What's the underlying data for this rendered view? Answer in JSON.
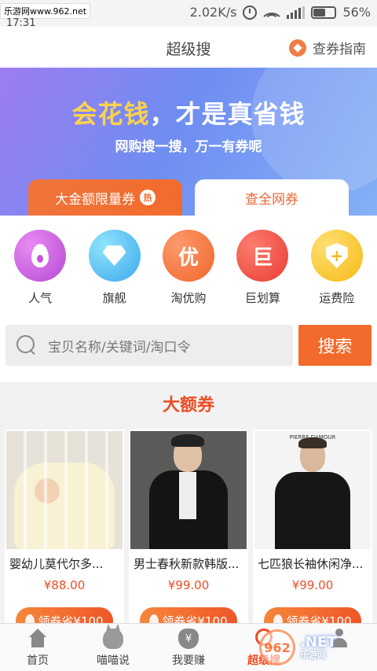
{
  "status_bar": {
    "watermark": "乐游网www.962.net",
    "time_fragment": "17:31",
    "speed": "2.02K/s",
    "battery": "56%"
  },
  "header": {
    "title": "超级搜",
    "guide_label": "查券指南"
  },
  "banner": {
    "headline_gold": "会花钱",
    "headline_rest": "，才是真省钱",
    "subline": "网购搜一搜，万一有券呢",
    "tabs": [
      {
        "label": "大金额限量券",
        "badge": "热"
      },
      {
        "label": "查全网券"
      }
    ]
  },
  "categories": [
    {
      "label": "人气",
      "icon": "flame-icon",
      "color": "#c257d9"
    },
    {
      "label": "旗舰",
      "icon": "diamond-icon",
      "color": "#3da8ee"
    },
    {
      "label": "淘优购",
      "icon": "you-icon",
      "glyph": "优",
      "color": "#f2652b"
    },
    {
      "label": "巨划算",
      "icon": "ju-icon",
      "glyph": "巨",
      "color": "#ea3c36"
    },
    {
      "label": "运费险",
      "icon": "shield-icon",
      "glyph": "+",
      "color": "#f7b914"
    }
  ],
  "search": {
    "placeholder": "宝贝名称/关键词/淘口令",
    "button_label": "搜索"
  },
  "section": {
    "title": "大额券"
  },
  "products": [
    {
      "name": "婴幼儿莫代尔多...",
      "price": "¥88.00",
      "coupon": "领券省¥100"
    },
    {
      "name": "男士春秋新款韩版...",
      "price": "¥99.00",
      "coupon": "领券省¥100"
    },
    {
      "name": "七匹狼长袖休闲净...",
      "price": "¥99.00",
      "coupon": "领券省¥100",
      "brand_text": "PIERRE DAMOUR"
    }
  ],
  "bottom_nav": [
    {
      "label": "首页",
      "icon": "home-icon"
    },
    {
      "label": "喵喵说",
      "icon": "cat-icon"
    },
    {
      "label": "我要赚",
      "icon": "money-bag-icon",
      "glyph": "¥"
    },
    {
      "label": "超级搜",
      "icon": "search-icon",
      "active": true
    },
    {
      "label": "",
      "icon": "profile-icon"
    }
  ],
  "watermark_bottom": {
    "logo": "962",
    "text": ".NET",
    "sub": "乐游网"
  },
  "colors": {
    "accent": "#f26b2d",
    "section_red": "#ec4e24",
    "banner_start": "#9d7cf0",
    "banner_end": "#84b1f6"
  }
}
